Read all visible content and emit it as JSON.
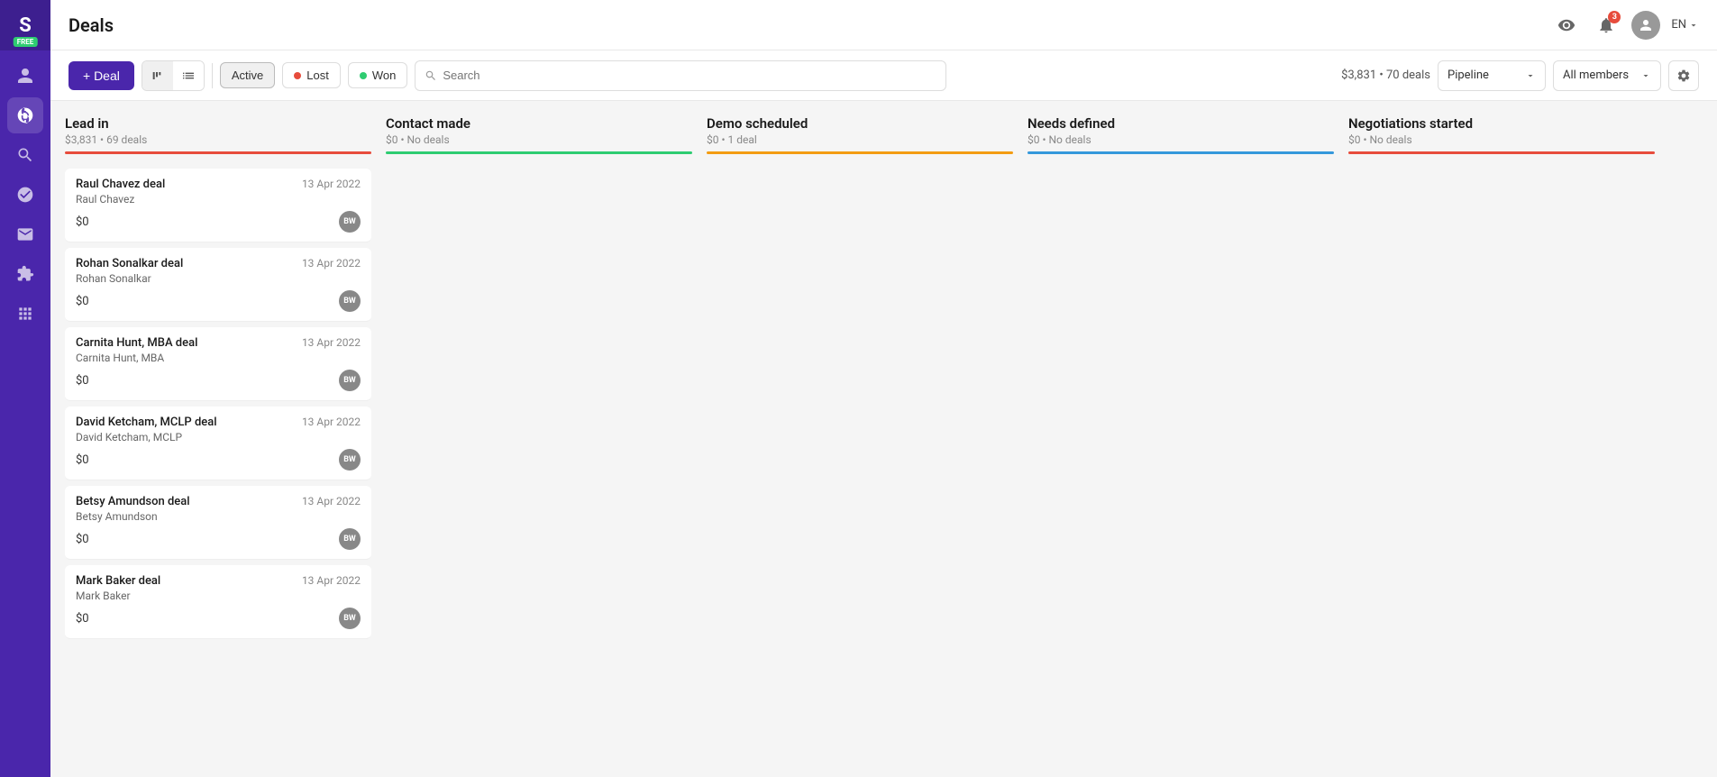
{
  "app": {
    "title": "Deals"
  },
  "sidebar": {
    "logo": "S",
    "free_badge": "FREE",
    "items": [
      {
        "id": "person",
        "icon": "person"
      },
      {
        "id": "deals",
        "icon": "dollar",
        "active": true
      },
      {
        "id": "search",
        "icon": "search"
      },
      {
        "id": "tasks",
        "icon": "check"
      },
      {
        "id": "mail",
        "icon": "mail"
      },
      {
        "id": "plugins",
        "icon": "puzzle"
      },
      {
        "id": "apps",
        "icon": "grid"
      }
    ]
  },
  "header": {
    "notification_count": "3",
    "lang": "EN"
  },
  "toolbar": {
    "add_button_label": "+ Deal",
    "filters": {
      "active_label": "Active",
      "lost_label": "Lost",
      "won_label": "Won"
    },
    "search_placeholder": "Search",
    "deals_summary": "$3,831 • 70 deals",
    "pipeline_label": "Pipeline",
    "all_members_label": "All members"
  },
  "columns": [
    {
      "id": "lead-in",
      "title": "Lead in",
      "meta": "$3,831 • 69 deals",
      "bar_color": "#e74c3c",
      "deals": [
        {
          "name": "Raul Chavez deal",
          "contact": "Raul Chavez",
          "amount": "$0",
          "date": "13 Apr 2022",
          "avatar": "BW"
        },
        {
          "name": "Rohan Sonalkar deal",
          "contact": "Rohan Sonalkar",
          "amount": "$0",
          "date": "13 Apr 2022",
          "avatar": "BW"
        },
        {
          "name": "Carnita Hunt, MBA deal",
          "contact": "Carnita Hunt, MBA",
          "amount": "$0",
          "date": "13 Apr 2022",
          "avatar": "BW"
        },
        {
          "name": "David Ketcham, MCLP deal",
          "contact": "David Ketcham, MCLP",
          "amount": "$0",
          "date": "13 Apr 2022",
          "avatar": "BW"
        },
        {
          "name": "Betsy Amundson deal",
          "contact": "Betsy Amundson",
          "amount": "$0",
          "date": "13 Apr 2022",
          "avatar": "BW"
        },
        {
          "name": "Mark Baker deal",
          "contact": "Mark Baker",
          "amount": "$0",
          "date": "13 Apr 2022",
          "avatar": "BW"
        }
      ]
    },
    {
      "id": "contact-made",
      "title": "Contact made",
      "meta": "$0 • No deals",
      "bar_color": "#2ecc71",
      "deals": []
    },
    {
      "id": "demo-scheduled",
      "title": "Demo scheduled",
      "meta": "$0 • 1 deal",
      "bar_color": "#f39c12",
      "deals": []
    },
    {
      "id": "needs-defined",
      "title": "Needs defined",
      "meta": "$0 • No deals",
      "bar_color": "#3498db",
      "deals": []
    },
    {
      "id": "negotiations-started",
      "title": "Negotiations started",
      "meta": "$0 • No deals",
      "bar_color": "#e74c3c",
      "deals": []
    }
  ]
}
